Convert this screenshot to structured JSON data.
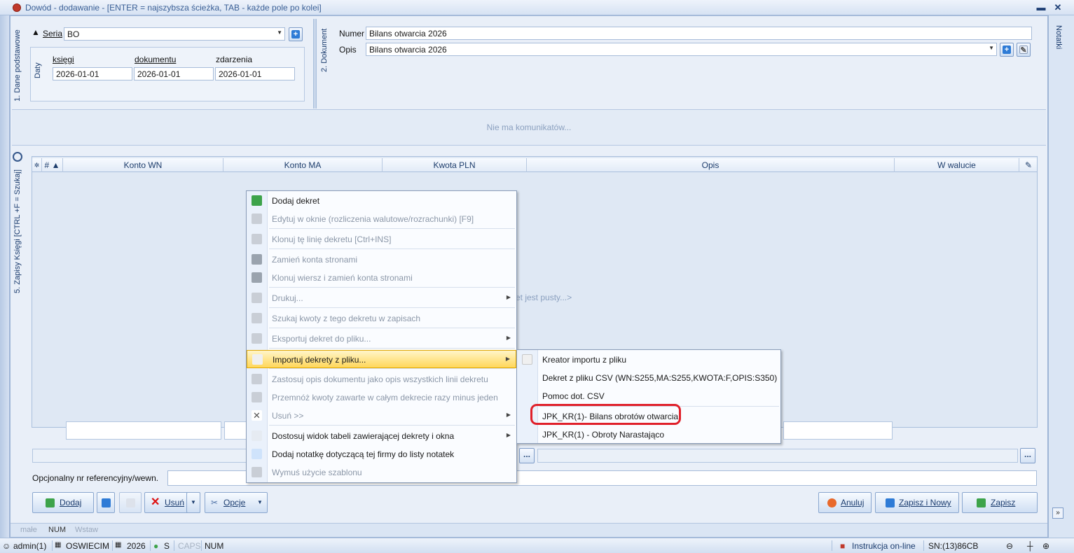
{
  "window": {
    "title": "Dowód - dodawanie - [ENTER = najszybsza ścieżka, TAB - każde pole po kolei]"
  },
  "tabs": {
    "dane_podstawowe": "1. Dane podstawowe",
    "dokument": "2. Dokument",
    "zapisy": "5. Zapisy Księgi [CTRL +F = Szukaj]",
    "notatki": "Notatki"
  },
  "seria": {
    "label": "Seria",
    "value": "BO"
  },
  "daty": {
    "group_label": "Daty",
    "ksiegi_label": "księgi",
    "ksiegi_value": "2026-01-01",
    "dokumentu_label": "dokumentu",
    "dokumentu_value": "2026-01-01",
    "zdarzenia_label": "zdarzenia",
    "zdarzenia_value": "2026-01-01"
  },
  "dokument": {
    "numer_label": "Numer",
    "numer_value": "Bilans otwarcia 2026",
    "opis_label": "Opis",
    "opis_value": "Bilans otwarcia 2026"
  },
  "messages": {
    "empty": "Nie ma komunikatów..."
  },
  "grid": {
    "columns": [
      "#",
      "Konto WN",
      "Konto MA",
      "Kwota PLN",
      "Opis",
      "W walucie"
    ],
    "empty_fragment": "et jest pusty...>"
  },
  "reference": {
    "label": "Opcjonalny nr referencyjny/wewn.",
    "value": ""
  },
  "buttons": {
    "dodaj": "Dodaj",
    "usun": "Usuń",
    "opcje": "Opcje",
    "anuluj": "Anuluj",
    "zapisz_nowy": "Zapisz i Nowy",
    "zapisz": "Zapisz"
  },
  "window_status": {
    "male": "małe",
    "num": "NUM",
    "wstaw": "Wstaw"
  },
  "context_menu": {
    "items": [
      {
        "label": "Dodaj dekret",
        "enabled": true,
        "submenu": false
      },
      {
        "label": "Edytuj w oknie (rozliczenia walutowe/rozrachunki) [F9]",
        "enabled": false,
        "submenu": false
      },
      {
        "label": "Klonuj tę linię dekretu [Ctrl+INS]",
        "enabled": false,
        "submenu": false
      },
      {
        "label": "Zamień konta stronami",
        "enabled": false,
        "submenu": false
      },
      {
        "label": "Klonuj wiersz i zamień konta stronami",
        "enabled": false,
        "submenu": false
      },
      {
        "label": "Drukuj...",
        "enabled": false,
        "submenu": true
      },
      {
        "label": "Szukaj kwoty z tego dekretu w zapisach",
        "enabled": false,
        "submenu": false
      },
      {
        "label": "Eksportuj dekret do pliku...",
        "enabled": false,
        "submenu": true
      },
      {
        "label": "Importuj dekrety z pliku...",
        "enabled": true,
        "submenu": true
      },
      {
        "label": "Zastosuj opis dokumentu jako opis wszystkich linii dekretu",
        "enabled": false,
        "submenu": false
      },
      {
        "label": "Przemnóż kwoty zawarte w całym dekrecie razy minus jeden",
        "enabled": false,
        "submenu": false
      },
      {
        "label": "Usuń >>",
        "enabled": false,
        "submenu": true
      },
      {
        "label": "Dostosuj widok tabeli zawierającej dekrety i okna",
        "enabled": true,
        "submenu": true
      },
      {
        "label": "Dodaj notatkę dotyczącą tej firmy do listy notatek",
        "enabled": true,
        "submenu": false
      },
      {
        "label": "Wymuś użycie szablonu",
        "enabled": false,
        "submenu": false
      }
    ]
  },
  "submenu": {
    "items": [
      {
        "label": "Kreator importu z pliku"
      },
      {
        "label": "Dekret z pliku CSV (WN:S255,MA:S255,KWOTA:F,OPIS:S350)"
      },
      {
        "label": "Pomoc dot. CSV"
      },
      {
        "label": "JPK_KR(1)- Bilans obrotów otwarcia"
      },
      {
        "label": "JPK_KR(1) - Obroty Narastająco"
      }
    ]
  },
  "statusbar": {
    "user": "admin(1)",
    "company": "OSWIECIM",
    "year": "2026",
    "s": "S",
    "caps": "CAPS",
    "num": "NUM",
    "instrukcja": "Instrukcja on-line",
    "sn": "SN:(13)86CB"
  },
  "colors": {
    "accent": "#2e7bd6",
    "highlight": "#ffd75a",
    "annotation": "#e0202a"
  }
}
